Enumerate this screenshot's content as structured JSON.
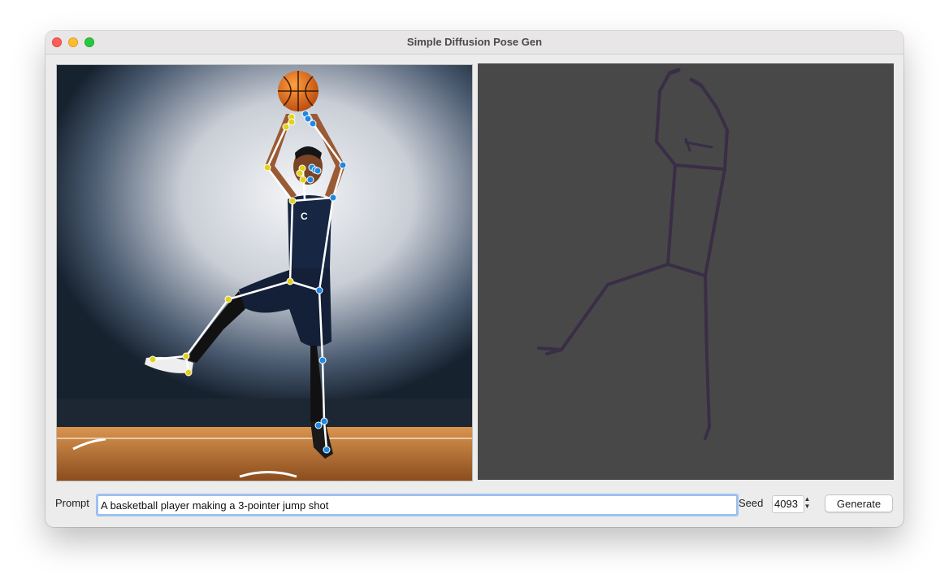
{
  "window": {
    "title": "Simple Diffusion Pose Gen"
  },
  "prompt": {
    "label": "Prompt",
    "value": "A basketball player making a 3-pointer jump shot"
  },
  "seed": {
    "label": "Seed",
    "value": "4093"
  },
  "generate_button": {
    "label": "Generate"
  },
  "jersey_text": "C",
  "colors": {
    "left_keypoint": "#e3d21a",
    "right_keypoint": "#1e88e5",
    "skeleton_line": "#ffffff",
    "pose_stick": "#3a2d46",
    "pose_bg": "#484848",
    "prompt_focus_ring": "#9ec1ef"
  },
  "icons": [
    "close-icon",
    "minimize-icon",
    "maximize-icon",
    "stepper-up-icon",
    "stepper-down-icon",
    "basketball-icon"
  ]
}
